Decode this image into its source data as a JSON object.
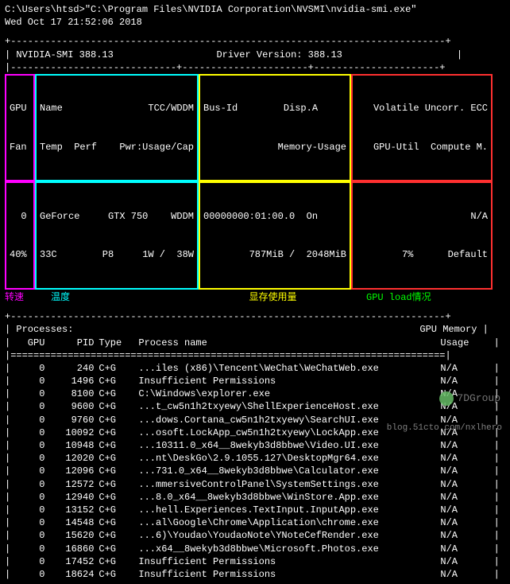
{
  "prompt": "C:\\Users\\htsd>\"C:\\Program Files\\NVIDIA Corporation\\NVSMI\\nvidia-smi.exe\"",
  "timestamp": "Wed Oct 17 21:52:06 2018",
  "header": {
    "smi_version": "NVIDIA-SMI 388.13",
    "driver_version": "Driver Version: 388.13"
  },
  "cols": {
    "c1_h1": "GPU",
    "c1_h2": "Fan",
    "c2_h1": "Name",
    "c2_h1b": "TCC/WDDM",
    "c2_h2": "Temp  Perf",
    "c2_h2b": "Pwr:Usage/Cap",
    "c3_h1": "Bus-Id        Disp.A",
    "c3_h2": "Memory-Usage",
    "c4_h1": "Volatile Uncorr. ECC",
    "c4_h2": "GPU-Util  Compute M."
  },
  "vals": {
    "c1_v1": "  0",
    "c1_v2": "40%",
    "c2_v1": "GeForce",
    "c2_v1b": "GTX 750    WDDM",
    "c2_v2": "33C",
    "c2_v2b": "P8     1W /  38W",
    "c3_v1": "00000000:01:00.0  On",
    "c3_v2": "787MiB /  2048MiB",
    "c4_v1": "N/A",
    "c4_v2": "7%      Default"
  },
  "labels": {
    "l1": "转速",
    "l2": "温度",
    "l3": "显存使用量",
    "l4": "GPU load情况"
  },
  "proc_header": {
    "title": "Processes:",
    "mem_title": "GPU Memory",
    "gpu": "GPU",
    "pid": "PID",
    "type": "Type",
    "name": "Process name",
    "usage": "Usage"
  },
  "processes": [
    {
      "gpu": "0",
      "pid": "240",
      "type": "C+G",
      "name": "...iles (x86)\\Tencent\\WeChat\\WeChatWeb.exe",
      "mem": "N/A"
    },
    {
      "gpu": "0",
      "pid": "1496",
      "type": "C+G",
      "name": "Insufficient Permissions",
      "mem": "N/A"
    },
    {
      "gpu": "0",
      "pid": "8100",
      "type": "C+G",
      "name": "C:\\Windows\\explorer.exe",
      "mem": "N/A"
    },
    {
      "gpu": "0",
      "pid": "9600",
      "type": "C+G",
      "name": "...t_cw5n1h2txyewy\\ShellExperienceHost.exe",
      "mem": "N/A"
    },
    {
      "gpu": "0",
      "pid": "9760",
      "type": "C+G",
      "name": "...dows.Cortana_cw5n1h2txyewy\\SearchUI.exe",
      "mem": "N/A"
    },
    {
      "gpu": "0",
      "pid": "10092",
      "type": "C+G",
      "name": "...osoft.LockApp_cw5n1h2txyewy\\LockApp.exe",
      "mem": "N/A"
    },
    {
      "gpu": "0",
      "pid": "10948",
      "type": "C+G",
      "name": "...10311.0_x64__8wekyb3d8bbwe\\Video.UI.exe",
      "mem": "N/A"
    },
    {
      "gpu": "0",
      "pid": "12020",
      "type": "C+G",
      "name": "...nt\\DeskGo\\2.9.1055.127\\DesktopMgr64.exe",
      "mem": "N/A"
    },
    {
      "gpu": "0",
      "pid": "12096",
      "type": "C+G",
      "name": "...731.0_x64__8wekyb3d8bbwe\\Calculator.exe",
      "mem": "N/A"
    },
    {
      "gpu": "0",
      "pid": "12572",
      "type": "C+G",
      "name": "...mmersiveControlPanel\\SystemSettings.exe",
      "mem": "N/A"
    },
    {
      "gpu": "0",
      "pid": "12940",
      "type": "C+G",
      "name": "...8.0_x64__8wekyb3d8bbwe\\WinStore.App.exe",
      "mem": "N/A"
    },
    {
      "gpu": "0",
      "pid": "13152",
      "type": "C+G",
      "name": "...hell.Experiences.TextInput.InputApp.exe",
      "mem": "N/A"
    },
    {
      "gpu": "0",
      "pid": "14548",
      "type": "C+G",
      "name": "...al\\Google\\Chrome\\Application\\chrome.exe",
      "mem": "N/A"
    },
    {
      "gpu": "0",
      "pid": "15620",
      "type": "C+G",
      "name": "...6)\\Youdao\\YoudaoNote\\YNoteCefRender.exe",
      "mem": "N/A"
    },
    {
      "gpu": "0",
      "pid": "16860",
      "type": "C+G",
      "name": "...x64__8wekyb3d8bbwe\\Microsoft.Photos.exe",
      "mem": "N/A"
    },
    {
      "gpu": "0",
      "pid": "17452",
      "type": "C+G",
      "name": "Insufficient Permissions",
      "mem": "N/A"
    },
    {
      "gpu": "0",
      "pid": "18624",
      "type": "C+G",
      "name": "Insufficient Permissions",
      "mem": "N/A"
    }
  ],
  "watermarks": {
    "wm1": "7DGroup",
    "wm2": "blog.51cto.com/nxlhero"
  }
}
